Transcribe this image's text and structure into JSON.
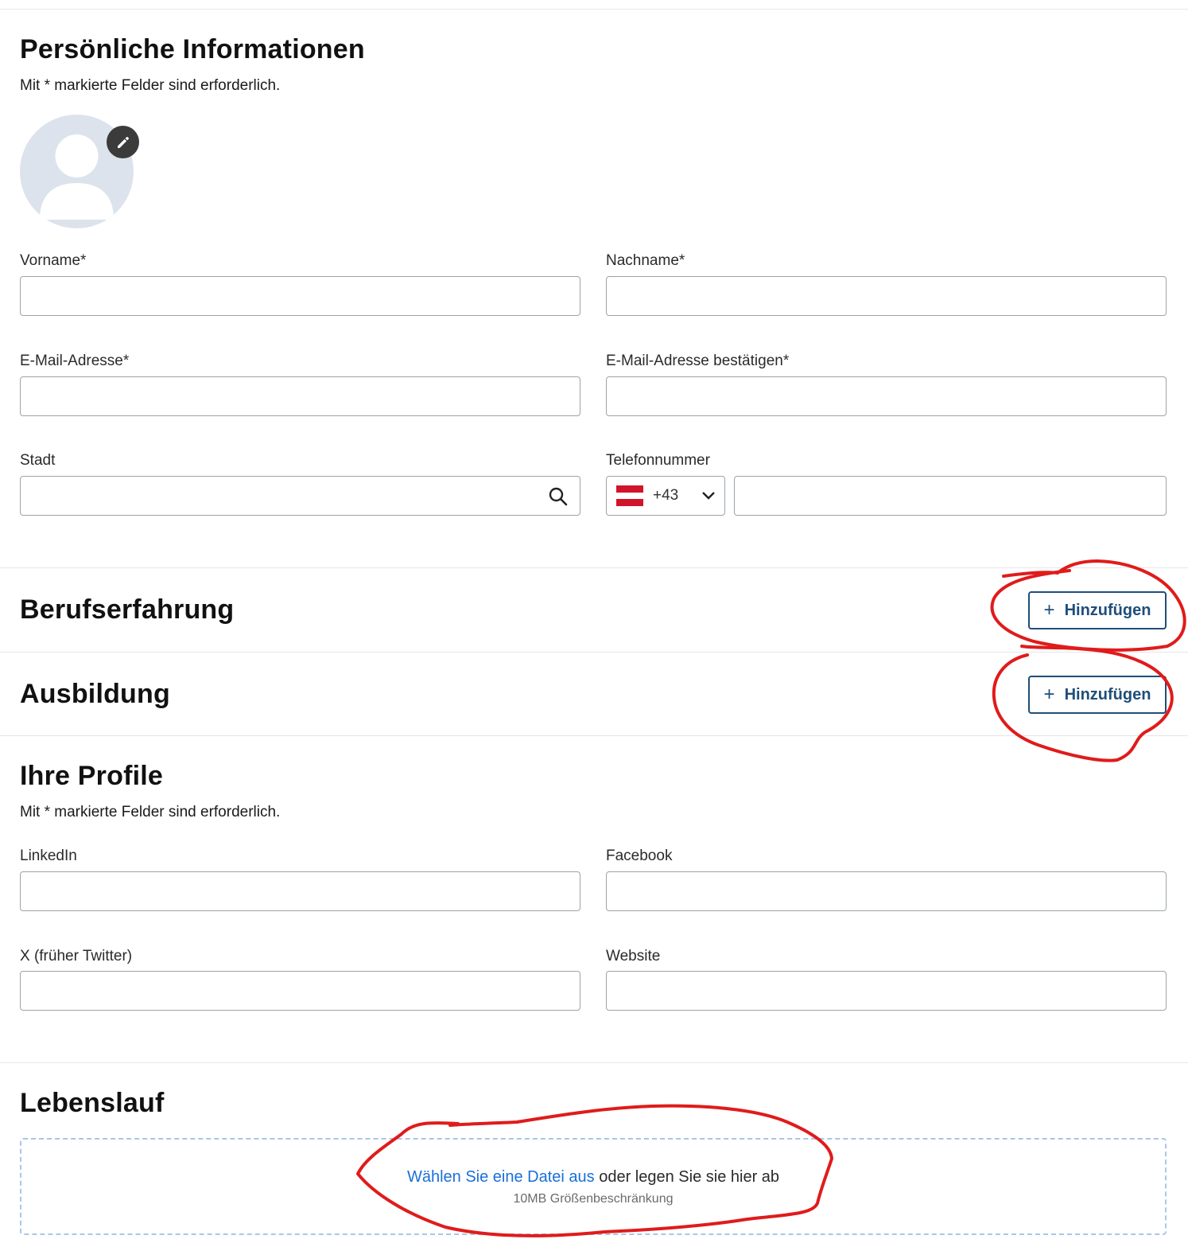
{
  "personal": {
    "title": "Persönliche Informationen",
    "required_note": "Mit * markierte Felder sind erforderlich.",
    "fields": {
      "first_name_label": "Vorname*",
      "last_name_label": "Nachname*",
      "email_label": "E-Mail-Adresse*",
      "email_confirm_label": "E-Mail-Adresse bestätigen*",
      "city_label": "Stadt",
      "phone_label": "Telefonnummer",
      "phone_country_code": "+43"
    }
  },
  "experience": {
    "title": "Berufserfahrung",
    "add_label": "Hinzufügen"
  },
  "education": {
    "title": "Ausbildung",
    "add_label": "Hinzufügen"
  },
  "profiles": {
    "title": "Ihre Profile",
    "required_note": "Mit * markierte Felder sind erforderlich.",
    "fields": {
      "linkedin_label": "LinkedIn",
      "facebook_label": "Facebook",
      "x_label": "X (früher Twitter)",
      "website_label": "Website"
    }
  },
  "resume": {
    "title": "Lebenslauf",
    "choose_file_link": "Wählen Sie eine Datei aus",
    "drop_text": "oder legen Sie sie hier ab",
    "size_limit": "10MB Größenbeschränkung"
  },
  "icons": {
    "avatar": "person-icon",
    "edit": "pencil-icon",
    "search": "search-icon",
    "flag": "austria-flag-icon",
    "dropdown": "chevron-down-icon",
    "add": "plus-icon"
  },
  "colors": {
    "accent": "#1f4e79",
    "link": "#1a6fd8",
    "annotation": "#e01b1b",
    "avatar_bg": "#dde3ed"
  }
}
